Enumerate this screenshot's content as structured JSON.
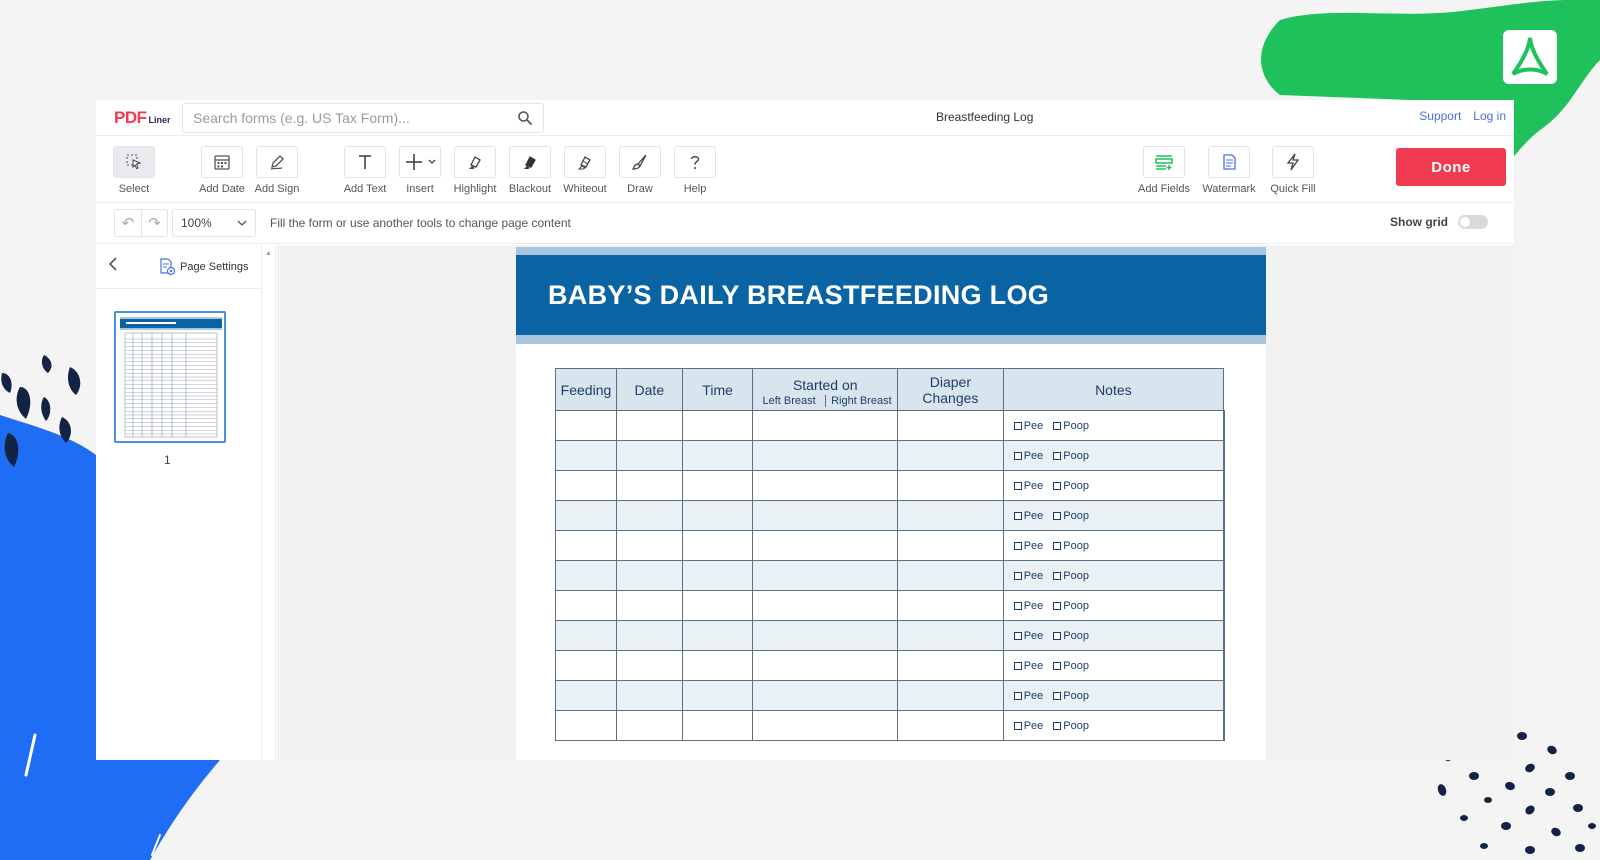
{
  "colors": {
    "accent_red": "#f03a4f",
    "link_blue": "#4a6ee0",
    "header_blue": "#0a64a4",
    "deco_green": "#1ec15a",
    "deco_blue": "#1f6cf5",
    "deco_navy": "#132345"
  },
  "topbar": {
    "logo_pdf": "PDF",
    "logo_liner": "Liner",
    "search_placeholder": "Search forms (e.g. US Tax Form)...",
    "doc_title": "Breastfeeding Log",
    "links": {
      "support": "Support",
      "login": "Log in"
    }
  },
  "toolbar": {
    "tools": {
      "select": {
        "label": "Select",
        "icon": "cursor-icon"
      },
      "add_date": {
        "label": "Add Date",
        "icon": "calendar-icon"
      },
      "add_sign": {
        "label": "Add Sign",
        "icon": "pen-icon"
      },
      "add_text": {
        "label": "Add Text",
        "icon": "text-icon"
      },
      "insert": {
        "label": "Insert",
        "icon": "plus-icon"
      },
      "highlight": {
        "label": "Highlight",
        "icon": "highlighter-icon"
      },
      "blackout": {
        "label": "Blackout",
        "icon": "marker-icon"
      },
      "whiteout": {
        "label": "Whiteout",
        "icon": "eraser-icon"
      },
      "draw": {
        "label": "Draw",
        "icon": "brush-icon"
      },
      "help": {
        "label": "Help",
        "icon": "question-icon"
      },
      "add_fields": {
        "label": "Add Fields",
        "icon": "fields-icon"
      },
      "watermark": {
        "label": "Watermark",
        "icon": "watermark-icon"
      },
      "quick_fill": {
        "label": "Quick Fill",
        "icon": "bolt-icon"
      }
    },
    "done_label": "Done"
  },
  "subbar": {
    "zoom": "100%",
    "hint": "Fill the form or use another tools to change page content",
    "show_grid_label": "Show grid"
  },
  "sidebar": {
    "page_settings_label": "Page Settings",
    "page_number": "1"
  },
  "document": {
    "title": "BABY’S DAILY BREASTFEEDING LOG",
    "columns": {
      "feeding": "Feeding",
      "date": "Date",
      "time": "Time",
      "started_on": "Started on",
      "left_breast": "Left Breast",
      "right_breast": "Right Breast",
      "diaper_line1": "Diaper",
      "diaper_line2": "Changes",
      "notes": "Notes"
    },
    "pee_label": "Pee",
    "poop_label": "Poop",
    "visible_rows": 11
  }
}
